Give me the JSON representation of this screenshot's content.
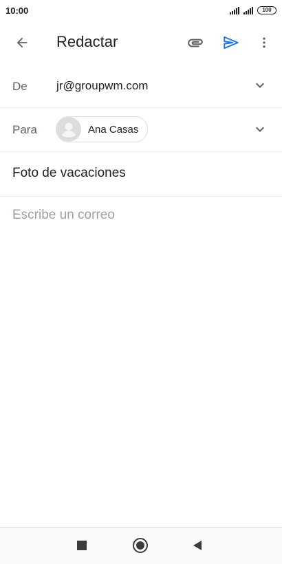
{
  "status_bar": {
    "time": "10:00",
    "battery": "100"
  },
  "app_bar": {
    "title": "Redactar",
    "icons": {
      "back": "arrow-back-icon",
      "attach": "paperclip-icon",
      "send": "send-icon",
      "more": "more-vert-icon"
    },
    "send_color": "#1a73e8"
  },
  "from": {
    "label": "De",
    "value": "jr@groupwm.com"
  },
  "to": {
    "label": "Para",
    "recipient_name": "Ana Casas"
  },
  "subject": {
    "value": "Foto de vacaciones"
  },
  "body": {
    "placeholder": "Escribe un correo"
  }
}
